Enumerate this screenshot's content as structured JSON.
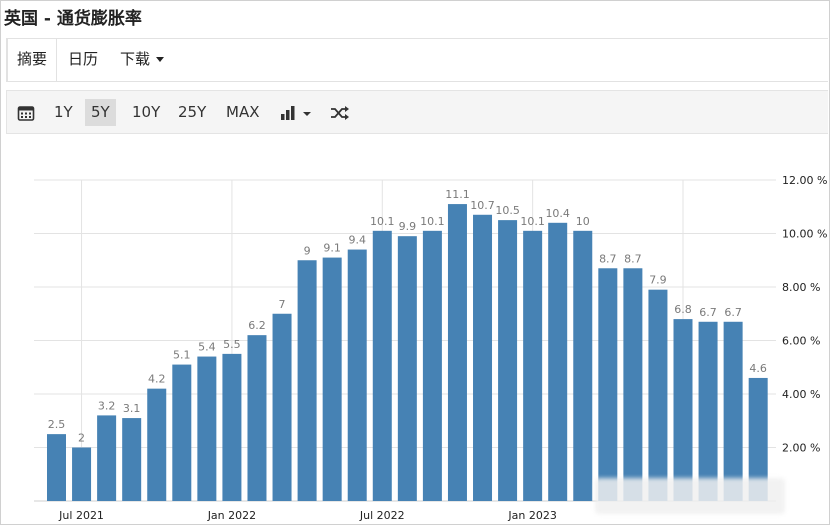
{
  "title": "英国 - 通货膨胀率",
  "tabs": [
    {
      "label": "摘要"
    },
    {
      "label": "日历"
    },
    {
      "label": "下载"
    }
  ],
  "toolbar": {
    "icons": [
      "calendar-icon",
      "bar-chart-icon",
      "shuffle-icon"
    ],
    "ranges": [
      "1Y",
      "5Y",
      "10Y",
      "25Y",
      "MAX"
    ],
    "selected_range": "5Y"
  },
  "colors": {
    "bar": "#4682b4",
    "label": "#7a7a7a",
    "grid": "#e3e3e3",
    "toolbar_bg": "#f5f5f5"
  },
  "chart_data": {
    "type": "bar",
    "values": [
      2.5,
      2,
      3.2,
      3.1,
      4.2,
      5.1,
      5.4,
      5.5,
      6.2,
      7,
      9,
      9.1,
      9.4,
      10.1,
      9.9,
      10.1,
      11.1,
      10.7,
      10.5,
      10.1,
      10.4,
      10.1,
      8.7,
      8.7,
      7.9,
      6.8,
      6.7,
      6.7,
      4.6
    ],
    "data_labels": [
      "2.5",
      "2",
      "3.2",
      "3.1",
      "4.2",
      "5.1",
      "5.4",
      "5.5",
      "6.2",
      "7",
      "9",
      "9.1",
      "9.4",
      "10.1",
      "9.9",
      "10.1",
      "11.1",
      "10.7",
      "10.5",
      "10.1",
      "10.4",
      "10",
      "8.7",
      "8.7",
      "7.9",
      "6.8",
      "6.7",
      "6.7",
      "4.6"
    ],
    "x_tick_labels": [
      "Jul 2021",
      "Jan 2022",
      "Jul 2022",
      "Jan 2023"
    ],
    "y_tick_labels": [
      "2.00 %",
      "4.00 %",
      "6.00 %",
      "8.00 %",
      "10.00 %",
      "12.00 %"
    ],
    "ylim": [
      0,
      12
    ],
    "y_axis_position": "right",
    "grid": true
  }
}
